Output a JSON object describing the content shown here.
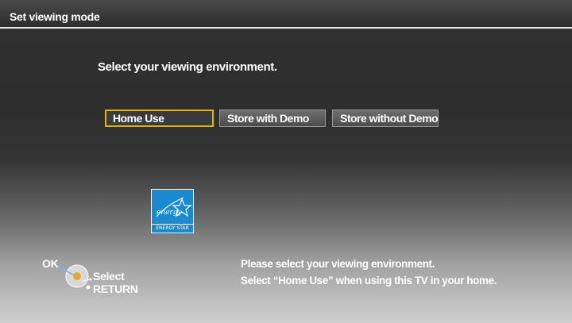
{
  "header": {
    "title": "Set viewing mode"
  },
  "prompt": "Select your viewing environment.",
  "options": [
    {
      "label": "Home Use",
      "selected": true
    },
    {
      "label": "Store with Demo",
      "selected": false
    },
    {
      "label": "Store without Demo",
      "selected": false
    }
  ],
  "badge": {
    "text": "ENERGY STAR",
    "logo_script": "energy",
    "color": "#1a8ad0"
  },
  "nav_help": {
    "ok": "OK",
    "select": "Select",
    "return": "RETURN"
  },
  "info": {
    "line1": "Please select your viewing environment.",
    "line2": "Select “Home Use” when using this TV in your home."
  },
  "colors": {
    "selection_border": "#e8b400",
    "text": "#ffffff"
  }
}
